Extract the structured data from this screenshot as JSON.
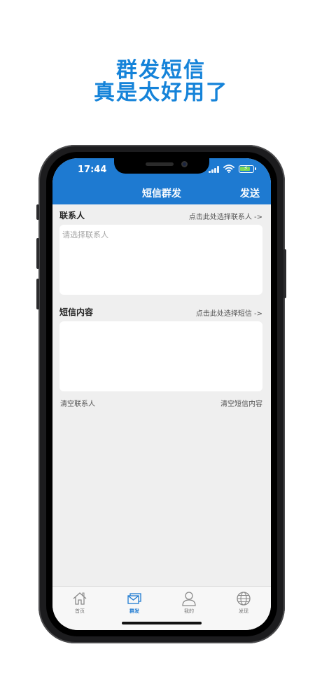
{
  "promo": {
    "headline_line1": "群发短信",
    "headline_line2": "真是太好用了"
  },
  "status_bar": {
    "time": "17:44",
    "battery_level": 0.8
  },
  "nav": {
    "title": "短信群发",
    "send_label": "发送"
  },
  "contacts": {
    "label": "联系人",
    "select_link": "点击此处选择联系人 ->",
    "placeholder": "请选择联系人"
  },
  "message": {
    "label": "短信内容",
    "select_link": "点击此处选择短信 ->",
    "value": ""
  },
  "actions": {
    "clear_contacts": "清空联系人",
    "clear_message": "清空短信内容"
  },
  "tabs": [
    {
      "label": "首页",
      "icon": "home-icon",
      "active": false
    },
    {
      "label": "群发",
      "icon": "mail-icon",
      "active": true
    },
    {
      "label": "我的",
      "icon": "person-icon",
      "active": false
    },
    {
      "label": "发现",
      "icon": "globe-icon",
      "active": false
    }
  ],
  "colors": {
    "headline": "#1583d9",
    "accent": "#1e7ad1",
    "background": "#efefef"
  }
}
